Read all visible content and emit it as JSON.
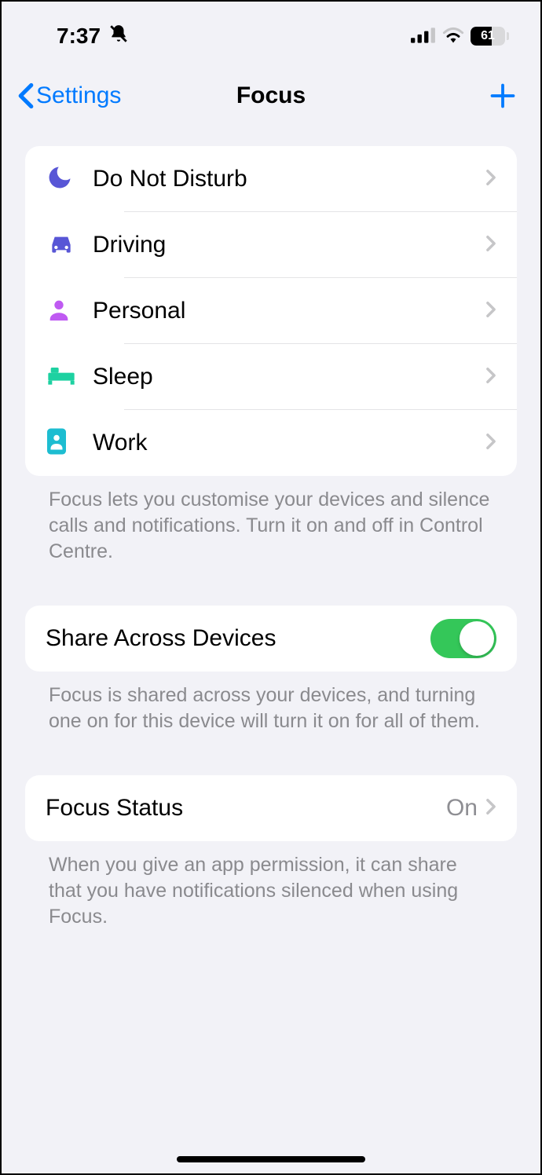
{
  "status": {
    "time": "7:37",
    "battery": "61"
  },
  "nav": {
    "back": "Settings",
    "title": "Focus"
  },
  "focus_modes": [
    {
      "label": "Do Not Disturb",
      "icon": "moon",
      "color": "#5856d6"
    },
    {
      "label": "Driving",
      "icon": "car",
      "color": "#5856d6"
    },
    {
      "label": "Personal",
      "icon": "person",
      "color": "#bf5af2"
    },
    {
      "label": "Sleep",
      "icon": "bed",
      "color": "#1dd1a1"
    },
    {
      "label": "Work",
      "icon": "badge",
      "color": "#1dbdd1"
    }
  ],
  "footer_modes": "Focus lets you customise your devices and silence calls and notifications. Turn it on and off in Control Centre.",
  "share": {
    "label": "Share Across Devices",
    "footer": "Focus is shared across your devices, and turning one on for this device will turn it on for all of them."
  },
  "focus_status": {
    "label": "Focus Status",
    "value": "On",
    "footer": "When you give an app permission, it can share that you have notifications silenced when using Focus."
  }
}
